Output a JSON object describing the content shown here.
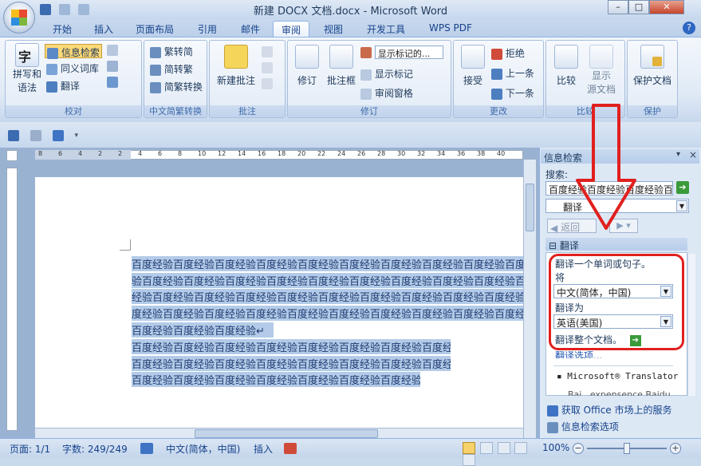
{
  "window": {
    "title": "新建 DOCX 文档.docx - Microsoft Word",
    "controls": [
      "–",
      "□",
      "✕"
    ]
  },
  "tabs": [
    "开始",
    "插入",
    "页面布局",
    "引用",
    "邮件",
    "审阅",
    "视图",
    "开发工具",
    "WPS PDF"
  ],
  "active_tab": "审阅",
  "ribbon": {
    "proofing": {
      "label": "校对",
      "spell_label": "拼写和\n语法",
      "spell_l1": "拼写和",
      "spell_l2": "语法",
      "research": "信息检索",
      "thesaurus": "同义词库",
      "translate": "翻译"
    },
    "chinese": {
      "label": "中文简繁转换",
      "to_simplified": "繁转简",
      "to_traditional": "简转繁",
      "convert": "简繁转换"
    },
    "comments": {
      "label": "批注",
      "new_comment": "新建批注"
    },
    "tracking": {
      "label": "修订",
      "track": "修订",
      "balloons": "批注框",
      "show_markup_dropdown": "显示标记的...",
      "show_markup": "显示标记",
      "review_pane": "审阅窗格"
    },
    "changes": {
      "label": "更改",
      "accept": "接受",
      "reject": "拒绝",
      "previous": "上一条",
      "next": "下一条"
    },
    "compare": {
      "label": "比较",
      "compare": "比较",
      "show_source": "显示\n源文档",
      "show_source_l1": "显示",
      "show_source_l2": "源文档"
    },
    "protect": {
      "label": "保护",
      "protect_doc": "保护文档"
    }
  },
  "document": {
    "lines": [
      "百度经验百度经验百度经验百度经验百度经验百度经验百度经验百度经验百度经验百度经",
      "验百度经验百度经验百度经验百度经验百度经验百度经验百度经验百度经验百度经验百度",
      "经验百度经验百度经验百度经验百度经验百度经验百度经验百度经验百度经验百度经验百",
      "度经验百度经验百度经验百度经验百度经验百度经验百度经验百度经验百度经验百度经验",
      "百度经验百度经验百度经验↵",
      "百度经验百度经验百度经验百度经验百度经验百度经验百度经验百度经验↵",
      "百度经验百度经验百度经验百度经验百度经验百度经验百度经验百度经验↵",
      "百度经验百度经验百度经验百度经验百度经验百度经验百度经验百度经验百↵"
    ]
  },
  "ruler_numbers": [
    "8",
    "6",
    "4",
    "2",
    "2",
    "4",
    "6",
    "8",
    "10",
    "12",
    "14",
    "16",
    "18",
    "20",
    "22",
    "24",
    "26",
    "28",
    "30",
    "32",
    "34",
    "36",
    "38",
    "40"
  ],
  "task_pane": {
    "title": "信息检索",
    "search_label": "搜索:",
    "search_value": "百度经验百度经验百度经验百",
    "service": "翻译",
    "back": "返回",
    "section_title": "翻译",
    "translate_hint": "翻译一个单词或句子。",
    "from_label": "将",
    "from_value": "中文(简体，中国)",
    "to_label": "翻译为",
    "to_value": "英语(美国)",
    "translate_doc": "翻译整个文档。",
    "options_link": "翻译选项...",
    "provider": "Microsoft® Translator",
    "provider2": "Bai...expensence Baidu...",
    "get_services": "获取 Office 市场上的服务",
    "research_options": "信息检索选项"
  },
  "status": {
    "page": "页面: 1/1",
    "words": "字数: 249/249",
    "language": "中文(简体，中国)",
    "mode": "插入",
    "zoom": "100%"
  },
  "colors": {
    "accent": "#15428b",
    "selection": "#b3cbe8",
    "annotation_red": "#e0201e"
  }
}
